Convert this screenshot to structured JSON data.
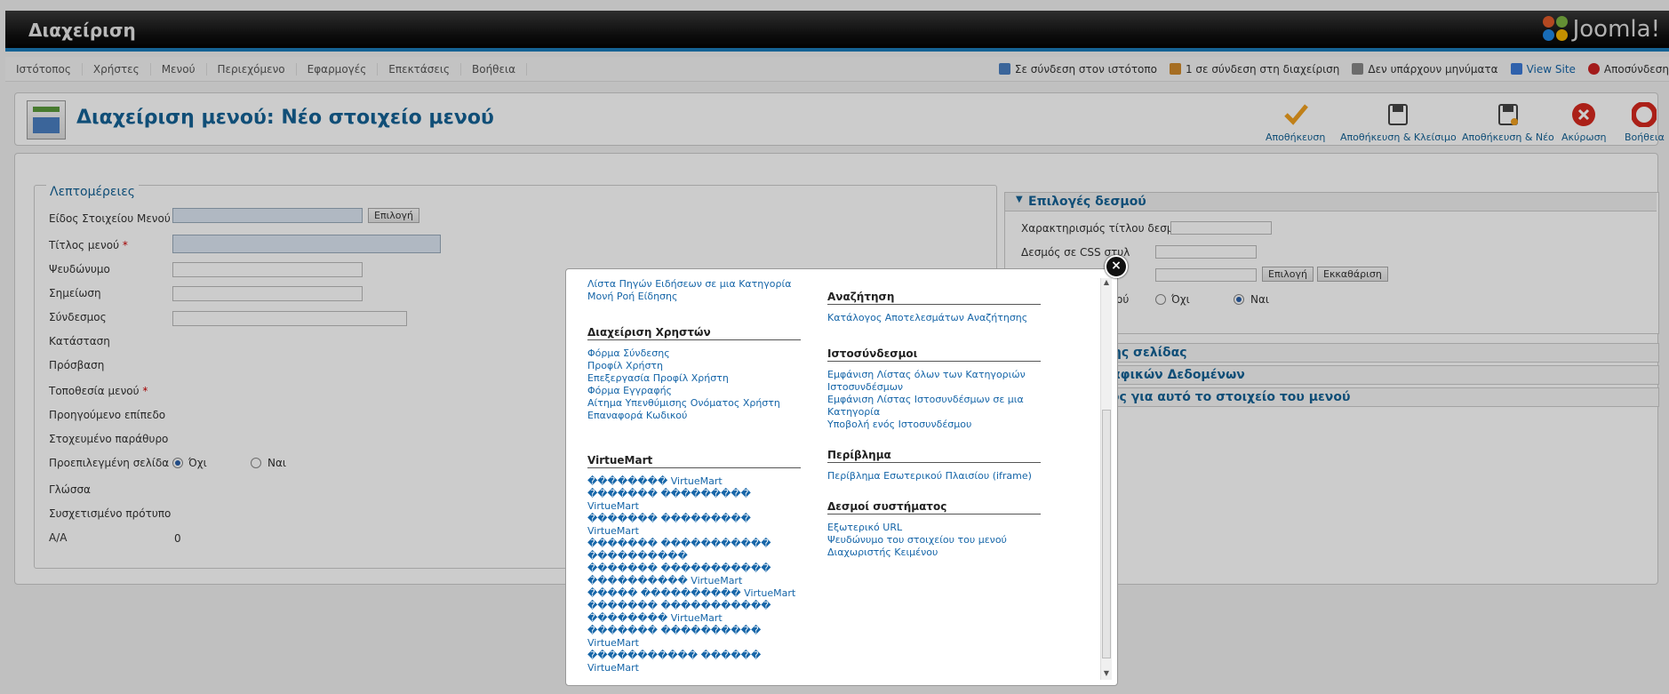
{
  "header": {
    "title": "Διαχείριση",
    "logo_text": "Joomla!"
  },
  "menu": {
    "items": [
      "Ιστότοπος",
      "Χρήστες",
      "Μενού",
      "Περιεχόμενο",
      "Εφαρμογές",
      "Επεκτάσεις",
      "Βοήθεια"
    ],
    "status": [
      {
        "label": "Σε σύνδεση στον ιστότοπο",
        "icon": "users-icon",
        "color": "#4a7fc1"
      },
      {
        "label": "1 σε σύνδεση στη διαχείριση",
        "icon": "user-icon",
        "color": "#d08a2c"
      },
      {
        "label": "Δεν υπάρχουν μηνύματα",
        "icon": "message-icon",
        "color": "#888888"
      },
      {
        "label": "View Site",
        "icon": "monitor-icon",
        "color": "#3b7ad8"
      },
      {
        "label": "Αποσύνδεση",
        "icon": "logout-icon",
        "color": "#cc2222"
      }
    ]
  },
  "toolbar": {
    "title": "Διαχείριση μενού: Νέο στοιχείο μενού",
    "buttons": [
      {
        "label": "Αποθήκευση",
        "icon": "save-icon"
      },
      {
        "label": "Αποθήκευση & Κλείσιμο",
        "icon": "save-close-icon"
      },
      {
        "label": "Αποθήκευση & Νέο",
        "icon": "save-new-icon"
      },
      {
        "label": "Ακύρωση",
        "icon": "cancel-icon"
      },
      {
        "label": "Βοήθεια",
        "icon": "help-icon"
      }
    ]
  },
  "details": {
    "legend": "Λεπτομέρειες",
    "menu_item_type": "Είδος Στοιχείου Μενού",
    "select_btn": "Επιλογή",
    "menu_title": "Τίτλος μενού",
    "alias": "Ψευδώνυμο",
    "note": "Σημείωση",
    "link": "Σύνδεσμος",
    "status": "Κατάσταση",
    "access": "Πρόσβαση",
    "menu_location": "Τοποθεσία μενού",
    "parent": "Προηγούμενο επίπεδο",
    "target": "Στοχευμένο παράθυρο",
    "default_page": "Προεπιλεγμένη σελίδα",
    "no": "Όχι",
    "yes": "Ναι",
    "language": "Γλώσσα",
    "template": "Συσχετισμένο πρότυπο",
    "id_label": "A/A",
    "id_value": "0",
    "required_mark": "*"
  },
  "options": {
    "header": "Επιλογές δεσμού",
    "link_title": "Χαρακτηρισμός τίτλου δεσμού",
    "css_style": "Δεσμός σε CSS στυλ",
    "select_btn": "Επιλογή",
    "clear_btn": "Εκκαθάριση",
    "fragment_label": "ού",
    "no": "Όχι",
    "yes": "Ναι",
    "section1": "σης σελίδας",
    "section2": "ραφικών Δεδομένων",
    "section3": "τος για αυτό το στοιχείο του μενού"
  },
  "modal": {
    "close": "×",
    "top_items": [
      "Λίστα Πηγών Ειδήσεων σε μια Κατηγορία",
      "Μονή Ροή Είδησης"
    ],
    "left_groups": [
      {
        "title": "Διαχείριση Χρηστών",
        "items": [
          "Φόρμα Σύνδεσης",
          "Προφίλ Χρήστη",
          "Επεξεργασία Προφίλ Χρήστη",
          "Φόρμα Εγγραφής",
          "Αίτημα Υπενθύμισης Ονόματος Χρήστη",
          "Επαναφορά Κωδικού"
        ]
      },
      {
        "title": "VirtueMart",
        "items": [
          "�������� VirtueMart",
          "������� ��������� VirtueMart",
          "������� ��������� VirtueMart",
          "������� ����������� ����������",
          "������� ����������� ���������� VirtueMart",
          "����� ���������� VirtueMart",
          "������� ����������� �������� VirtueMart",
          "������� ���������� VirtueMart",
          "����������� ������ VirtueMart"
        ]
      }
    ],
    "right_groups": [
      {
        "title": "Αναζήτηση",
        "items": [
          "Κατάλογος Αποτελεσμάτων Αναζήτησης"
        ]
      },
      {
        "title": "Ιστοσύνδεσμοι",
        "items": [
          "Εμφάνιση Λίστας όλων των Κατηγοριών Ιστοσυνδέσμων",
          "Εμφάνιση Λίστας Ιστοσυνδέσμων σε μια Κατηγορία",
          "Υποβολή ενός Ιστοσυνδέσμου"
        ]
      },
      {
        "title": "Περίβλημα",
        "items": [
          "Περίβλημα Εσωτερικού Πλαισίου (iframe)"
        ]
      },
      {
        "title": "Δεσμοί συστήματος",
        "items": [
          "Εξωτερικό URL",
          "Ψευδώνυμο του στοιχείου του μενού",
          "Διαχωριστής Κειμένου"
        ]
      }
    ]
  }
}
